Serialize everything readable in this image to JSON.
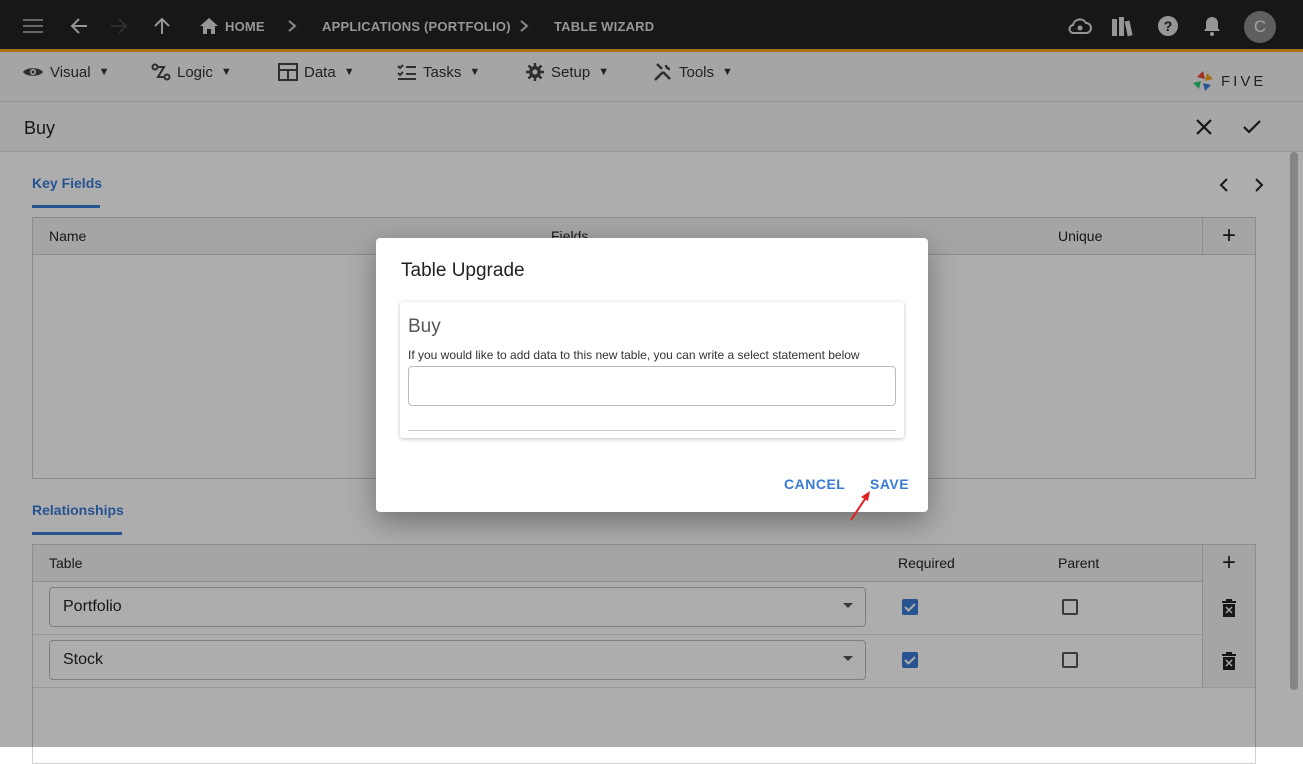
{
  "topbar": {
    "breadcrumbs": [
      "HOME",
      "APPLICATIONS (PORTFOLIO)",
      "TABLE WIZARD"
    ],
    "avatar_initial": "C"
  },
  "menubar": {
    "items": [
      "Visual",
      "Logic",
      "Data",
      "Tasks",
      "Setup",
      "Tools"
    ],
    "caret": "▼",
    "brand": "FIVE"
  },
  "page": {
    "title": "Buy"
  },
  "key_fields": {
    "tab_label": "Key Fields",
    "columns": [
      "Name",
      "Fields",
      "Unique"
    ]
  },
  "relationships": {
    "tab_label": "Relationships",
    "columns": [
      "Table",
      "Required",
      "Parent"
    ],
    "rows": [
      {
        "table": "Portfolio",
        "required": true,
        "parent": false
      },
      {
        "table": "Stock",
        "required": true,
        "parent": false
      }
    ]
  },
  "dialog": {
    "title": "Table Upgrade",
    "card_title": "Buy",
    "description": "If you would like to add data to this new table, you can write a select statement below",
    "input_value": "",
    "cancel_label": "CANCEL",
    "save_label": "SAVE"
  },
  "colors": {
    "accent": "#3a7bd5",
    "topbar": "#222222",
    "topbar_border": "#f5a623",
    "annotation_arrow": "#e02020"
  }
}
